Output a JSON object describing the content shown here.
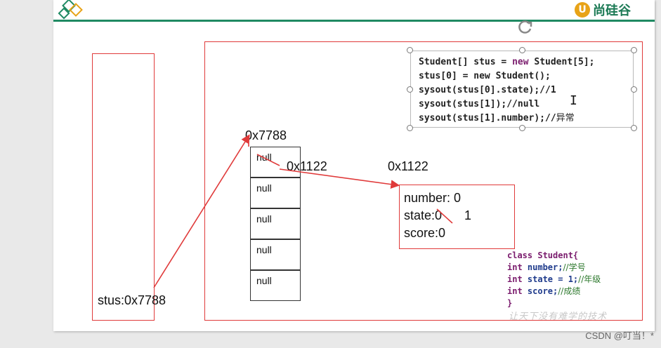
{
  "header": {
    "logo_right_mark": "U",
    "logo_right_text": "尚硅谷"
  },
  "stack": {
    "var_label": "stus:0x7788"
  },
  "array": {
    "address": "0x7788",
    "cells": [
      "null",
      "null",
      "null",
      "null",
      "null"
    ],
    "cell0_reference": "0x1122"
  },
  "object": {
    "address": "0x1122",
    "fields": {
      "number": "number: 0",
      "state_old": "state:0",
      "state_new": "1",
      "score": "score:0"
    }
  },
  "code": {
    "lines": [
      {
        "pre": "Student[] stus = ",
        "kw": "new",
        "post": " Student[5];"
      },
      {
        "pre": "stus[0] = new Student();",
        "kw": "",
        "post": ""
      },
      {
        "pre": "sysout(stus[0].state);//1",
        "kw": "",
        "post": ""
      },
      {
        "pre": "sysout(stus[1]);//null",
        "kw": "",
        "post": ""
      },
      {
        "pre": "sysout(stus[1].number);//",
        "kw": "",
        "post": "",
        "cn": "异常"
      }
    ]
  },
  "class_def": {
    "line1": "class Student{",
    "line2_kw": "int",
    "line2_field": " number;",
    "line2_comment": "//学号",
    "line3_kw": "int",
    "line3_field": " state = 1;",
    "line3_comment": "//年级",
    "line4_kw": "int",
    "line4_field": " score;",
    "line4_comment": "//成绩",
    "line5": "}"
  },
  "watermark": "让天下没有难学的技术",
  "footer": "CSDN @叮当！*",
  "colors": {
    "accent_green": "#1f8a63",
    "box_red": "#e03a3a",
    "keyword_purple": "#7b1d6e",
    "highlight_yellow": "#ffe800"
  }
}
